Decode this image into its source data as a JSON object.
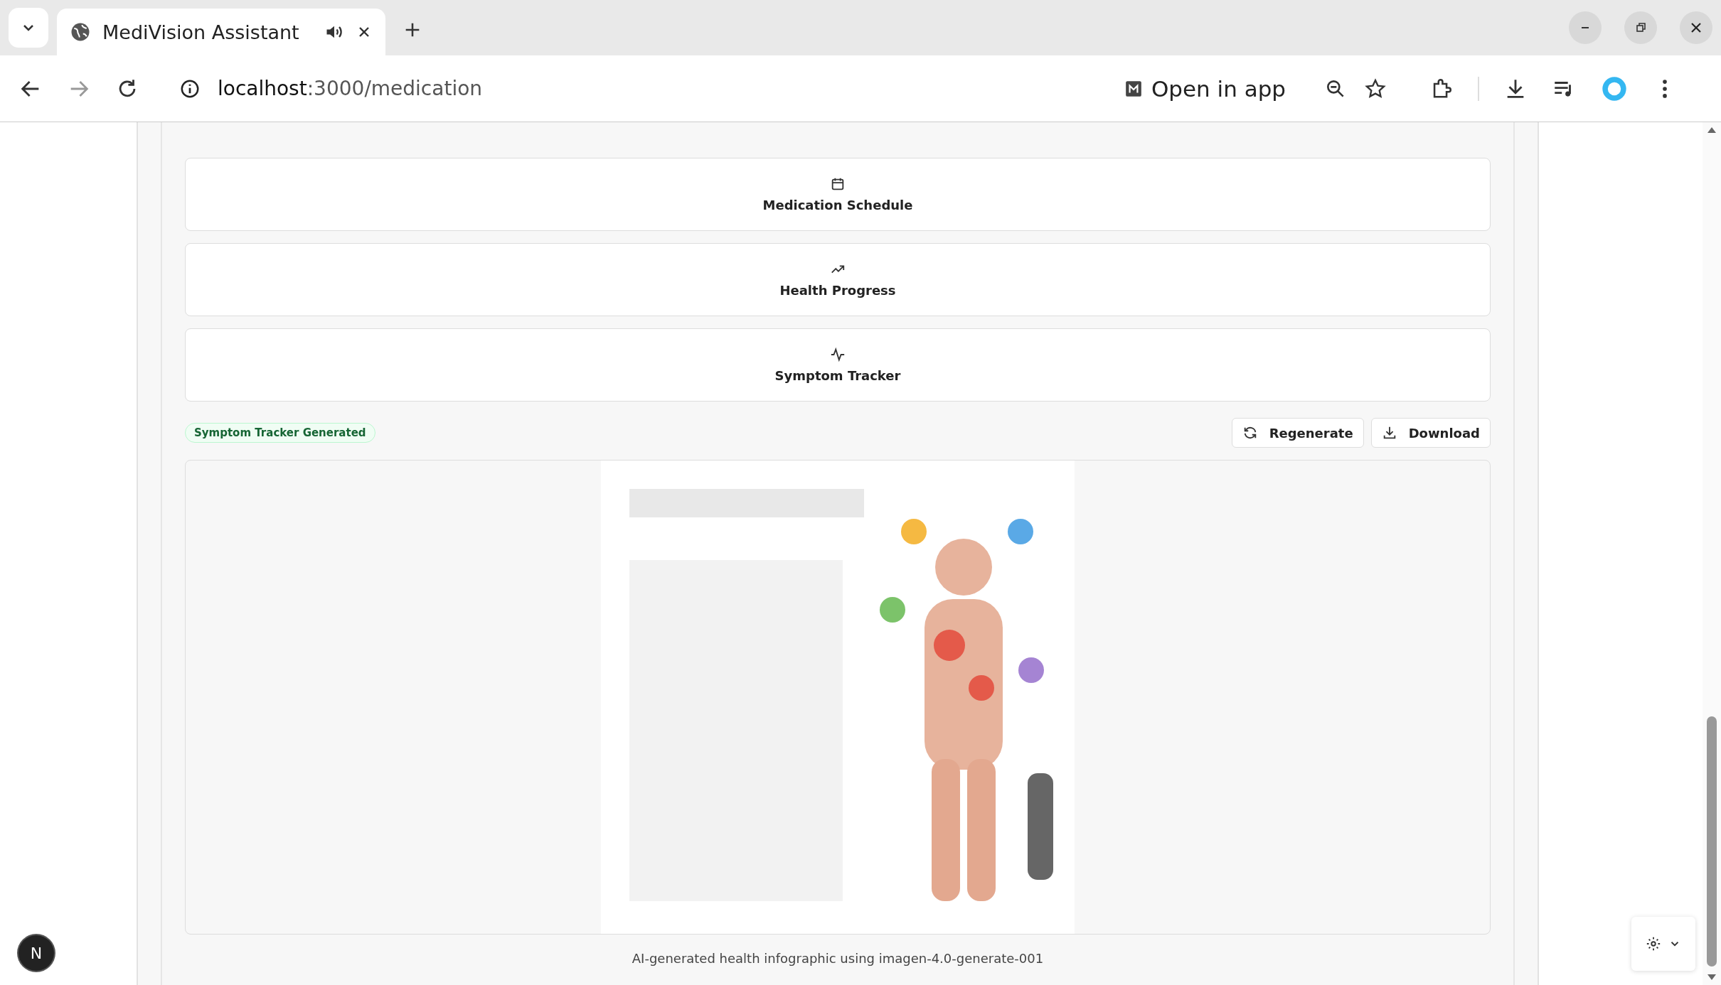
{
  "browser": {
    "tab": {
      "title": "MediVision Assistant",
      "audio": true
    },
    "url": {
      "host": "localhost",
      "path": ":3000/medication"
    },
    "open_in_app": "Open in app"
  },
  "options": [
    {
      "label": "Medication Schedule",
      "kind": "calendar"
    },
    {
      "label": "Health Progress",
      "kind": "trend"
    },
    {
      "label": "Symptom Tracker",
      "kind": "pulse"
    }
  ],
  "status_badge": "Symptom Tracker Generated",
  "actions": [
    {
      "label": "Regenerate",
      "kind": "regenerate"
    },
    {
      "label": "Download",
      "kind": "download"
    }
  ],
  "caption": "AI-generated health infographic using imagen-4.0-generate-001",
  "dev_badge": "N"
}
